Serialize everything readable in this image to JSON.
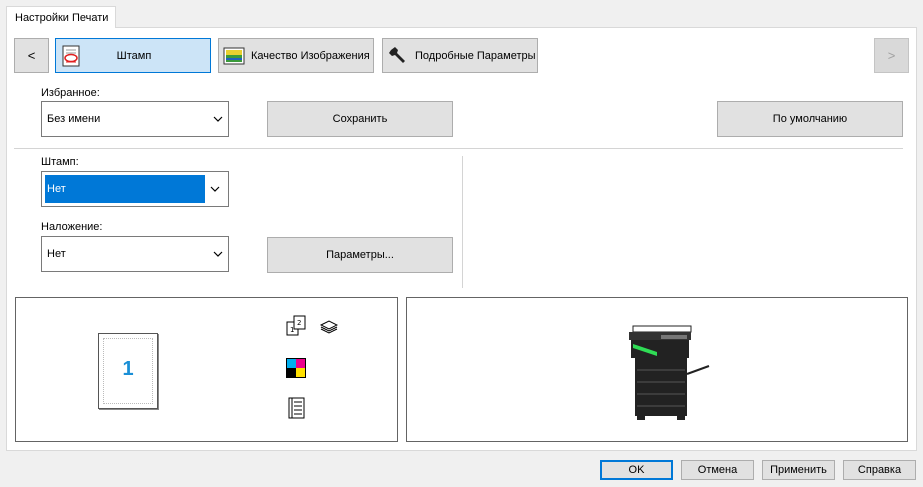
{
  "tab": {
    "label": "Настройки Печати"
  },
  "toolbar": {
    "prev_label": "<",
    "next_label": ">",
    "buttons": [
      {
        "label": "Штамп",
        "icon": "stamp-icon",
        "active": true
      },
      {
        "label": "Качество Изображения",
        "icon": "image-quality-icon",
        "active": false
      },
      {
        "label": "Подробные Параметры",
        "icon": "wrench-icon",
        "active": false
      }
    ]
  },
  "favorites": {
    "label": "Избранное:",
    "value": "Без имени",
    "save_label": "Сохранить",
    "default_label": "По умолчанию"
  },
  "stamp": {
    "label": "Штамп:",
    "value": "Нет"
  },
  "overlay": {
    "label": "Наложение:",
    "value": "Нет",
    "params_label": "Параметры..."
  },
  "preview": {
    "page_number": "1",
    "icons": [
      "duplex-icon",
      "stack-icon",
      "color-icon",
      "binding-icon"
    ]
  },
  "colors": {
    "accent": "#0078d7",
    "page_number": "#1a8fd6"
  },
  "dialog": {
    "ok_label": "OK",
    "cancel_label": "Отмена",
    "apply_label": "Применить",
    "help_label": "Справка"
  }
}
